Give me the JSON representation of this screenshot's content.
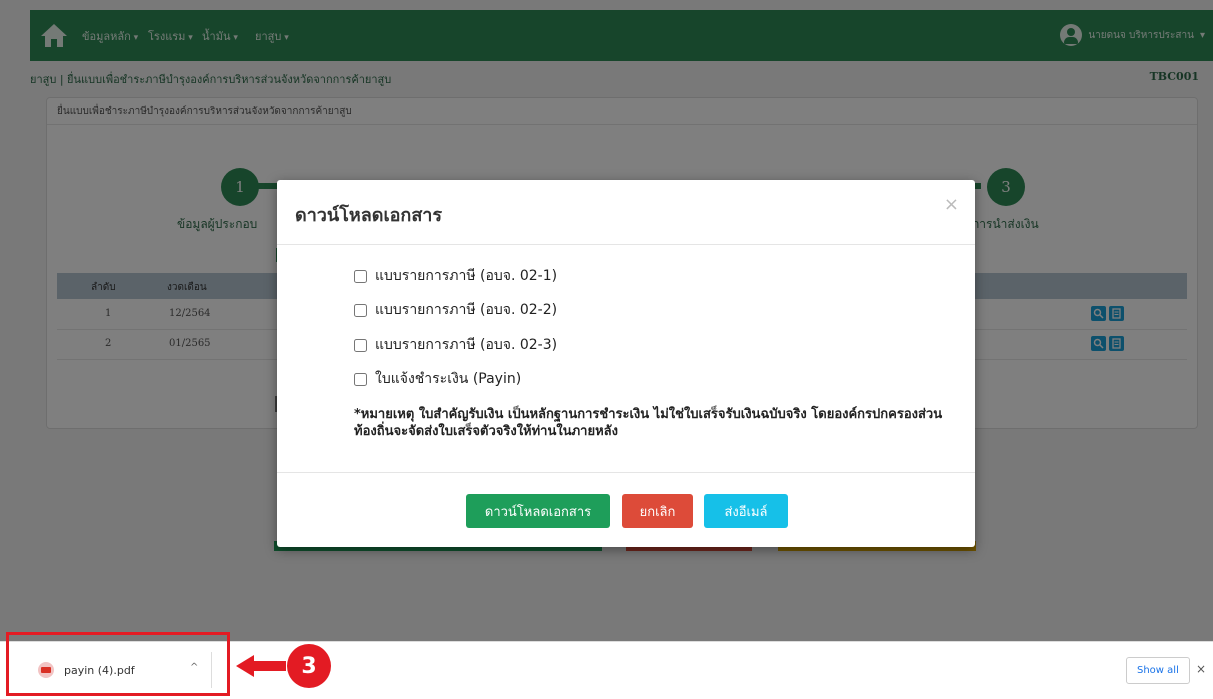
{
  "navbar": {
    "menus": [
      "ข้อมูลหลัก",
      "โรงแรม",
      "น้ำมัน",
      "ยาสูบ"
    ],
    "user_label": "นายดนจ บริหารประสาน"
  },
  "breadcrumb": {
    "section": "ยาสูบ",
    "separator": "|",
    "page": "ยื่นแบบเพื่อชำระภาษีบำรุงองค์การบริหารส่วนจังหวัดจากการค้ายาสูบ",
    "code": "TBC001"
  },
  "card": {
    "header": "ยื่นแบบเพื่อชำระภาษีบำรุงองค์การบริหารส่วนจังหวัดจากการค้ายาสูบ"
  },
  "wizard": {
    "step1_number": "1",
    "step1_label": "ข้อมูลผู้ประกอบ",
    "step3_number": "3",
    "step3_label": "การนำส่งเงิน"
  },
  "table": {
    "headers": [
      "ลำดับ",
      "งวดเดือน"
    ],
    "rows": [
      {
        "no": "1",
        "period": "12/2564"
      },
      {
        "no": "2",
        "period": "01/2565"
      }
    ]
  },
  "modal": {
    "title": "ดาวน์โหลดเอกสาร",
    "close": "×",
    "options": [
      "แบบรายการภาษี (อบจ. 02-1)",
      "แบบรายการภาษี (อบจ. 02-2)",
      "แบบรายการภาษี (อบจ. 02-3)",
      "ใบแจ้งชำระเงิน (Payin)"
    ],
    "note": "*หมายเหตุ ใบสำคัญรับเงิน เป็นหลักฐานการชำระเงิน ไม่ใช่ใบเสร็จรับเงินฉบับจริง โดยองค์กรปกครองส่วนท้องถิ่นจะจัดส่งใบเสร็จตัวจริงให้ท่านในภายหลัง",
    "buttons": {
      "download": "ดาวน์โหลดเอกสาร",
      "cancel": "ยกเลิก",
      "email": "ส่งอีเมล์"
    }
  },
  "download_shelf": {
    "filename": "payin (4).pdf",
    "chevron": "^",
    "show_all": "Show all",
    "close": "×"
  },
  "annotation": {
    "step_number": "3"
  },
  "colors": {
    "nav_green": "#2e8b57",
    "download_button": "#1e9e5a",
    "cancel_button": "#dd4b39",
    "email_button": "#16c0e8",
    "annotation_red": "#e31b23"
  }
}
